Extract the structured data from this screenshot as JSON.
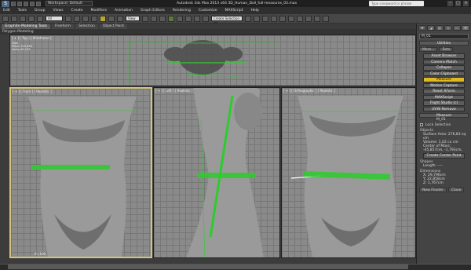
{
  "titlebar": {
    "workspace": "Workspace: Default",
    "title": "Autodesk 3ds Max 2013 x64    3D_Human_Doll_full-measures_03.max",
    "search_placeholder": "Type a keyword or phrase"
  },
  "menu": [
    "Edit",
    "Tools",
    "Group",
    "Views",
    "Create",
    "Modifiers",
    "Animation",
    "Graph Editors",
    "Rendering",
    "Customize",
    "MAXScript",
    "Help"
  ],
  "toolbar": {
    "view_drop": "View",
    "selset_drop": "Create Selection Se"
  },
  "ribbon": {
    "tabs": [
      "Graphite Modeling Tools",
      "Freeform",
      "Selection",
      "Object Paint"
    ],
    "active": "Graphite Modeling Tools",
    "sub": "Polygon Modeling"
  },
  "viewports": {
    "top": {
      "label": "[ + ] [ Top ] [ Wireframe ]",
      "stats": [
        "Total",
        "Polys: 123,456",
        "Verts: 61,234"
      ]
    },
    "front": {
      "label": "[ + ] [ Front ] [ Realistic ]"
    },
    "left": {
      "label": "[ + ] [ Left ] [ Realistic ]"
    },
    "ortho": {
      "label": "[ + ] [ Orthographic ] [ Realistic ]"
    }
  },
  "command_panel": {
    "object_name": "M_01",
    "utilities_header": "Utilities",
    "more": "More...",
    "sets": "Sets",
    "buttons": [
      "Asset Browser",
      "Camera Match",
      "Collapse",
      "Color Clipboard",
      "Measure",
      "Motion Capture",
      "Reset XForm",
      "MAXScript",
      "Flight Studio (c)",
      "UVW Remove"
    ],
    "active_button": "Measure",
    "measure_header": "Measure",
    "measure_obj": "M_01",
    "lock_selection": "Lock Selection",
    "objects_label": "Objects",
    "surface_area": "Surface Area: 276,83 sq cm",
    "volume": "Volume: 1,02 cu cm",
    "center_of_mass": "Center of Mass:",
    "center_vals": "-45,857cm, -1,793cm,",
    "create_center_point": "Create Center Point",
    "shapes_label": "Shapes",
    "length": "Length: ----",
    "dimensions_label": "Dimensions",
    "dim_x": "X: 29,796cm",
    "dim_y": "Y: 22,858cm",
    "dim_z": "Z: 1,767cm",
    "new_floater": "New Floater",
    "close": "Close"
  },
  "status": {
    "coords": "0 / 100"
  },
  "colors": {
    "measure": "#2ccc2c",
    "active_border": "#d5c47a",
    "active_btn": "#e0b820"
  }
}
